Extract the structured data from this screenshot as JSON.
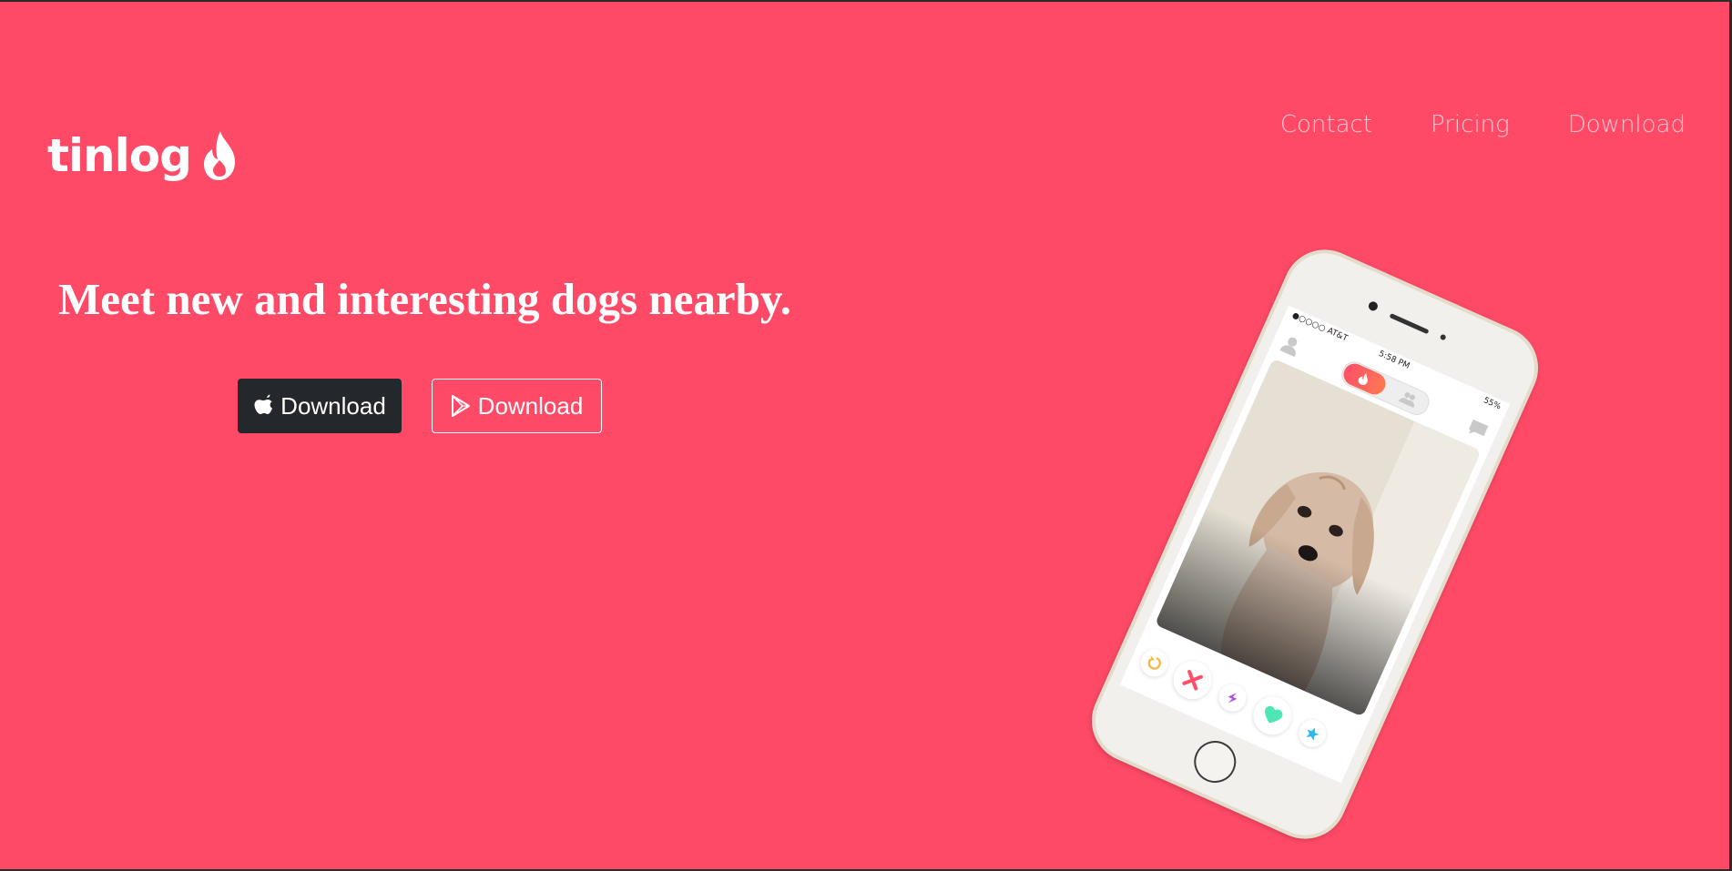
{
  "brand": {
    "name": "tinlog",
    "logo_icon": "flame-icon",
    "background_color": "#ff4a67"
  },
  "nav": {
    "items": [
      {
        "label": "Contact"
      },
      {
        "label": "Pricing"
      },
      {
        "label": "Download"
      }
    ]
  },
  "hero": {
    "headline": "Meet new and interesting dogs nearby.",
    "buttons": [
      {
        "label": "Download",
        "icon": "apple-icon",
        "style": "dark"
      },
      {
        "label": "Download",
        "icon": "google-play-icon",
        "style": "outline"
      }
    ]
  },
  "phone": {
    "carrier": "●○○○○ AT&T",
    "time": "5:58 PM",
    "battery": "55%",
    "action_icons": [
      "rewind-icon",
      "nope-icon",
      "boost-icon",
      "like-icon",
      "superlike-icon"
    ]
  }
}
